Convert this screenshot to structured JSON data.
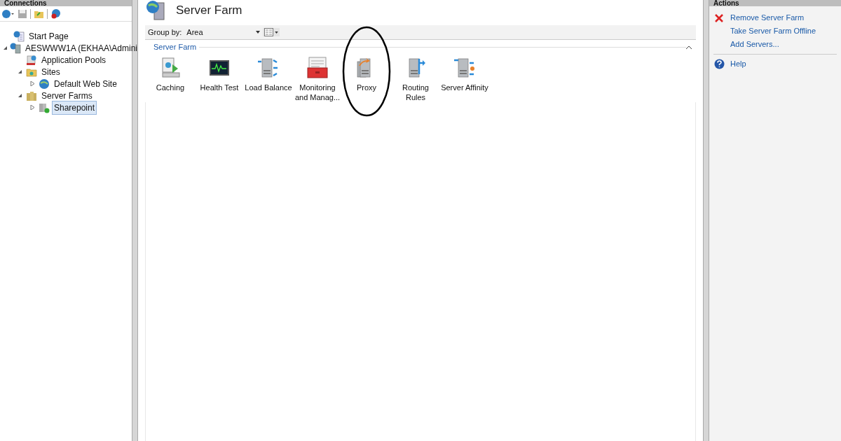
{
  "connections": {
    "title": "Connections",
    "tree": [
      {
        "label": "Start Page",
        "kind": "start",
        "selected": false
      },
      {
        "label": "AESWWW1A (EKHAA\\Admini",
        "kind": "server",
        "expanded": true,
        "selected": false,
        "children": [
          {
            "label": "Application Pools",
            "kind": "pools",
            "selected": false
          },
          {
            "label": "Sites",
            "kind": "folder",
            "expanded": true,
            "selected": false,
            "children": [
              {
                "label": "Default Web Site",
                "kind": "globe",
                "expanded": false,
                "selected": false
              }
            ]
          },
          {
            "label": "Server Farms",
            "kind": "farms",
            "expanded": true,
            "selected": false,
            "children": [
              {
                "label": "Sharepoint",
                "kind": "farm",
                "expanded": false,
                "selected": true
              }
            ]
          }
        ]
      }
    ]
  },
  "page": {
    "title": "Server Farm",
    "group_by_label": "Group by:",
    "group_by_value": "Area",
    "group": "Server Farm",
    "features": [
      {
        "label": "Caching",
        "kind": "caching"
      },
      {
        "label": "Health Test",
        "kind": "health"
      },
      {
        "label": "Load Balance",
        "kind": "balance"
      },
      {
        "label": "Monitoring and Manag...",
        "kind": "monitor"
      },
      {
        "label": "Proxy",
        "kind": "proxy",
        "circled": true
      },
      {
        "label": "Routing Rules",
        "kind": "routing"
      },
      {
        "label": "Server Affinity",
        "kind": "affinity"
      }
    ]
  },
  "actions": {
    "title": "Actions",
    "items": [
      {
        "label": "Remove Server Farm",
        "kind": "remove"
      },
      {
        "label": "Take Server Farm Offline",
        "kind": "plain"
      },
      {
        "label": "Add Servers...",
        "kind": "plain"
      },
      {
        "label": "Help",
        "kind": "help"
      }
    ]
  }
}
